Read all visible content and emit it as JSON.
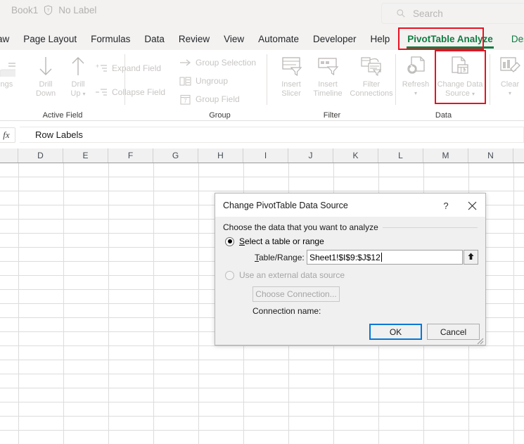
{
  "titlebar": {
    "doc_name": "Book1",
    "sensitivity_icon": "shield-question-icon",
    "sensitivity_label": "No Label",
    "search_icon": "search-icon",
    "search_placeholder": "Search"
  },
  "tabs": [
    {
      "label": "aw",
      "state": "clipped"
    },
    {
      "label": "Page Layout",
      "state": "normal"
    },
    {
      "label": "Formulas",
      "state": "normal"
    },
    {
      "label": "Data",
      "state": "normal"
    },
    {
      "label": "Review",
      "state": "normal"
    },
    {
      "label": "View",
      "state": "normal"
    },
    {
      "label": "Automate",
      "state": "normal"
    },
    {
      "label": "Developer",
      "state": "normal"
    },
    {
      "label": "Help",
      "state": "normal"
    },
    {
      "label": "PivotTable Analyze",
      "state": "active-contextual"
    },
    {
      "label": "Design",
      "state": "contextual"
    }
  ],
  "ribbon": {
    "groups": [
      {
        "caption": "Active Field",
        "items": [
          {
            "label": "ettings",
            "icon": "field-settings-icon",
            "type": "clipped"
          },
          {
            "label": "Drill\nDown",
            "icon": "drill-down-arrow-icon",
            "type": "big"
          },
          {
            "label": "Drill\nUp",
            "icon": "drill-up-arrow-icon",
            "type": "big-split"
          },
          {
            "label": "Expand Field",
            "icon": "expand-field-icon",
            "type": "small"
          },
          {
            "label": "Collapse Field",
            "icon": "collapse-field-icon",
            "type": "small"
          }
        ]
      },
      {
        "caption": "Group",
        "items": [
          {
            "label": "Group Selection",
            "icon": "group-selection-arrow-icon",
            "type": "small"
          },
          {
            "label": "Ungroup",
            "icon": "ungroup-icon",
            "type": "small"
          },
          {
            "label": "Group Field",
            "icon": "group-field-calendar-icon",
            "type": "small"
          }
        ]
      },
      {
        "caption": "Filter",
        "items": [
          {
            "label": "Insert\nSlicer",
            "icon": "insert-slicer-icon",
            "type": "big"
          },
          {
            "label": "Insert\nTimeline",
            "icon": "insert-timeline-icon",
            "type": "big"
          },
          {
            "label": "Filter\nConnections",
            "icon": "filter-connections-icon",
            "type": "big"
          }
        ]
      },
      {
        "caption": "Data",
        "items": [
          {
            "label": "Refresh",
            "icon": "refresh-icon",
            "type": "big-split"
          },
          {
            "label": "Change Data\nSource",
            "icon": "change-data-source-icon",
            "type": "big-split",
            "highlighted": true
          }
        ]
      },
      {
        "caption": "",
        "items": [
          {
            "label": "Clear",
            "icon": "clear-icon",
            "type": "big-split"
          }
        ]
      }
    ],
    "group_labels": {
      "active_field": "Active Field",
      "group": "Group",
      "filter": "Filter",
      "data": "Data"
    },
    "item_labels": {
      "field_settings": "ettings",
      "drill_down_1": "Drill",
      "drill_down_2": "Down",
      "drill_up_1": "Drill",
      "drill_up_2": "Up",
      "expand_field": "Expand Field",
      "collapse_field": "Collapse Field",
      "group_selection": "Group Selection",
      "ungroup": "Ungroup",
      "group_field": "Group Field",
      "insert_slicer_1": "Insert",
      "insert_slicer_2": "Slicer",
      "insert_timeline_1": "Insert",
      "insert_timeline_2": "Timeline",
      "filter_connections_1": "Filter",
      "filter_connections_2": "Connections",
      "refresh": "Refresh",
      "change_data_source_1": "Change Data",
      "change_data_source_2": "Source",
      "clear": "Clear"
    }
  },
  "formula_bar": {
    "fx_label": "fx",
    "value": "Row Labels"
  },
  "grid": {
    "columns": [
      "D",
      "E",
      "F",
      "G",
      "H",
      "I",
      "J",
      "K",
      "L",
      "M",
      "N"
    ]
  },
  "dialog": {
    "title": "Change PivotTable Data Source",
    "help_icon": "question-mark-icon",
    "close_icon": "close-icon",
    "legend": "Choose the data that you want to analyze",
    "option_range_label": "Select a table or range",
    "option_range_accel": "S",
    "option_range_rest": "elect a table or range",
    "option_range_selected": true,
    "table_range_label": "Table/Range:",
    "table_range_accel": "T",
    "table_range_rest": "able/Range:",
    "table_range_value": "Sheet1!$I$9:$J$12",
    "range_picker_icon": "collapse-dialog-up-arrow-icon",
    "option_external_label": "Use an external data source",
    "option_external_selected": false,
    "choose_connection_label": "Choose Connection...",
    "connection_name_label": "Connection name:",
    "ok_label": "OK",
    "cancel_label": "Cancel",
    "resize_grip": "resize-grip-icon"
  },
  "highlights": {
    "color": "#e81123",
    "targets": [
      "PivotTable Analyze",
      "Change Data Source"
    ]
  }
}
